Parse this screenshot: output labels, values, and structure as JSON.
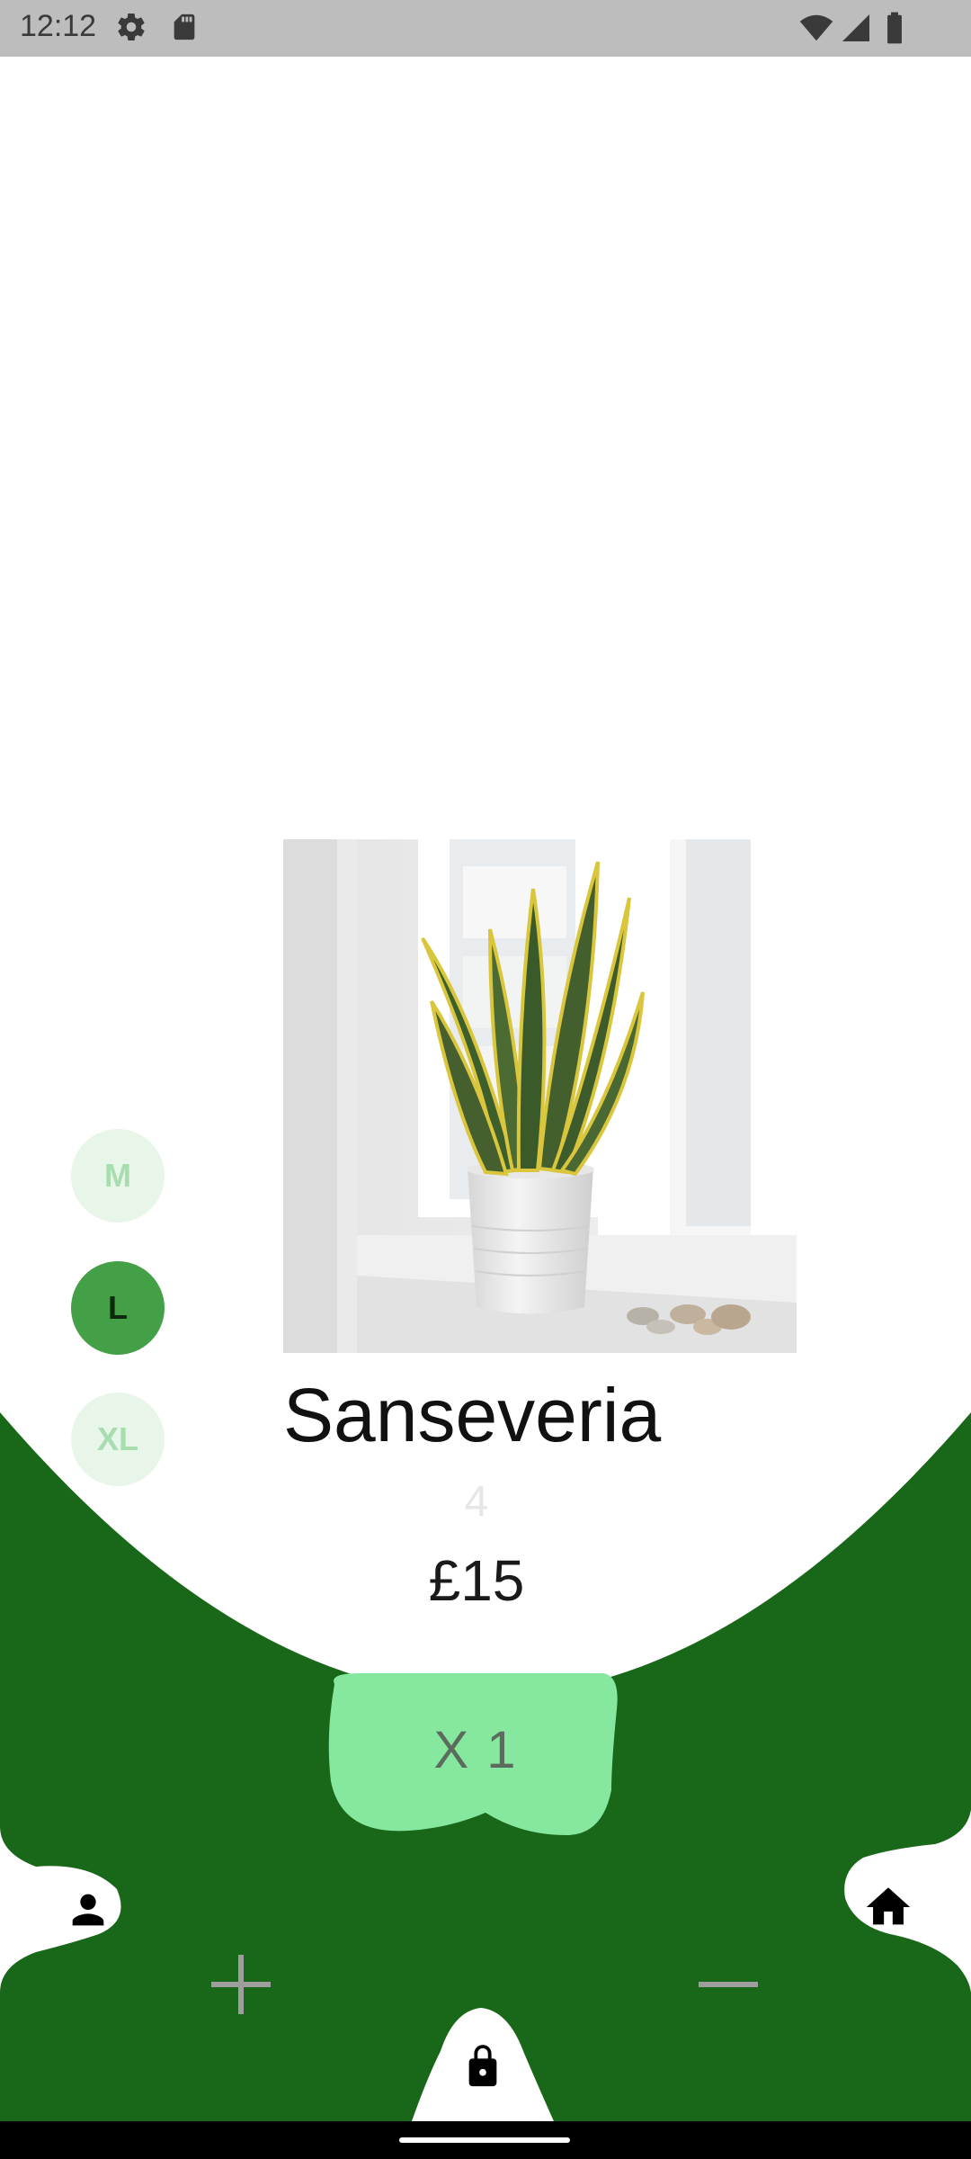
{
  "status_bar": {
    "time": "12:12",
    "icons": [
      "settings-icon",
      "sd-card-icon",
      "wifi-icon",
      "cellular-signal-icon",
      "battery-icon"
    ]
  },
  "product": {
    "name": "Sanseveria",
    "stock": "4",
    "price": "£15",
    "image": "snake-plant-photo"
  },
  "sizes": [
    {
      "label": "M",
      "selected": false
    },
    {
      "label": "L",
      "selected": true
    },
    {
      "label": "XL",
      "selected": false
    }
  ],
  "quantity": {
    "label": "X 1"
  },
  "actions": {
    "profile": "person-icon",
    "home": "home-icon",
    "increase": "plus-icon",
    "decrease": "minus-icon",
    "checkout": "lock-icon"
  },
  "colors": {
    "dark_green": "#196719",
    "light_green": "#86e89e",
    "size_selected": "#43a047",
    "size_unselected": "#e8f5e9"
  }
}
